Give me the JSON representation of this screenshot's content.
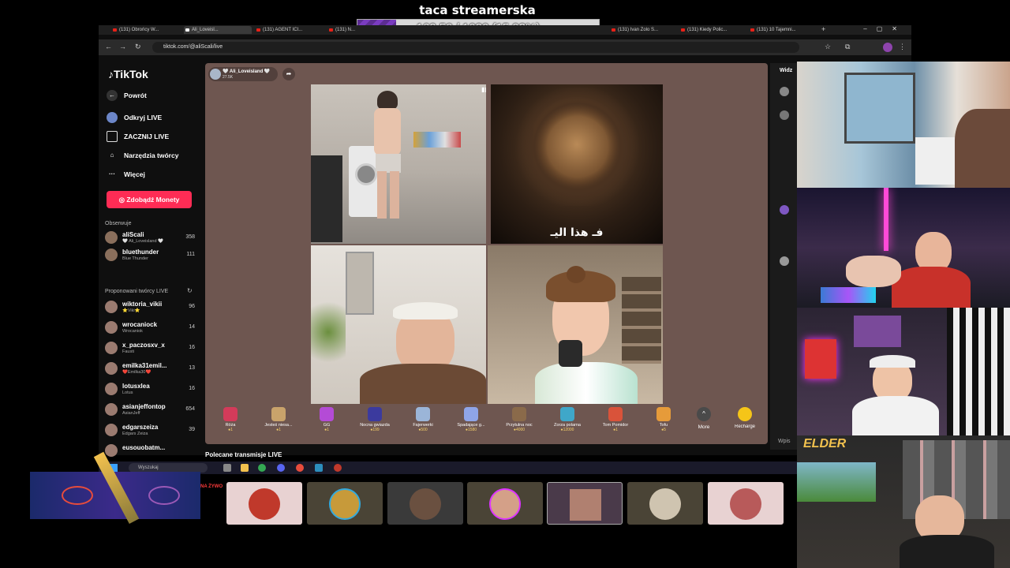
{
  "overlay": {
    "title": "taca streamerska",
    "goal_text": "162.50 / 1020 (15.93%)",
    "goal_progress": 0.1593,
    "goal_colors": [
      "#5c2d91",
      "#7a3cc0"
    ]
  },
  "browser": {
    "tabs": [
      "(131) Obrońcy W...",
      "Ali_Loveisl...",
      "(131) AGENT ICI...",
      "(131) N...",
      "(131) Ivan Zolo S...",
      "(131) Kiedy Polic...",
      "(131) 10 Tajemni..."
    ],
    "url": "tiktok.com/@aliScali/live"
  },
  "tiktok": {
    "logo": "TikTok",
    "nav": [
      "Powrót",
      "Odkryj LIVE",
      "ZACZNIJ LIVE",
      "Narzędzia twórcy",
      "Więcej"
    ],
    "coins_button": "Zdobądź Monety",
    "following_title": "Obserwuje",
    "following": [
      {
        "name": "aliScali",
        "sub": "🤍 Ali_Loveisland 🤍",
        "count": "358"
      },
      {
        "name": "bluethunder",
        "sub": "Blue Thunder",
        "count": "111"
      }
    ],
    "suggested_title": "Proponowani twórcy LIVE",
    "suggested": [
      {
        "name": "wiktoria_vikii",
        "sub": "⭐Viki⭐",
        "count": "96"
      },
      {
        "name": "wrocaniock",
        "sub": "Wrocaniok",
        "count": "14"
      },
      {
        "name": "x_paczosxv_x",
        "sub": "Fausti",
        "count": "16"
      },
      {
        "name": "emilka31emil...",
        "sub": "❤️Emilka30❤️",
        "count": "13"
      },
      {
        "name": "lotusxlea",
        "sub": "Lotus",
        "count": "16"
      },
      {
        "name": "asianjeffontop",
        "sub": "AsianJeff",
        "count": "654"
      },
      {
        "name": "edgarszeiza",
        "sub": "Edgars Zeiza",
        "count": "39"
      },
      {
        "name": "eusouobatm...",
        "sub": "",
        "count": ""
      }
    ],
    "host": {
      "name": "🤍 Ali_Loveisland 🤍",
      "viewers": "27.5K"
    },
    "lion_caption": "فـ هذا اليـ",
    "gifts": [
      {
        "name": "Róża",
        "price": "1",
        "color": "#d33b5a"
      },
      {
        "name": "Jesteś niesa...",
        "price": "1",
        "color": "#c9a36b"
      },
      {
        "name": "GG",
        "price": "1",
        "color": "#b44bd6"
      },
      {
        "name": "Nocna gwiazda",
        "price": "199",
        "color": "#3b3a9e"
      },
      {
        "name": "Fajerwerki",
        "price": "500",
        "color": "#9bb5d8"
      },
      {
        "name": "Spadające g...",
        "price": "1580",
        "color": "#8fa5e8"
      },
      {
        "name": "Przytulna noc",
        "price": "4000",
        "color": "#8a6a4a"
      },
      {
        "name": "Zorza polarna",
        "price": "12000",
        "color": "#3fa7c9"
      },
      {
        "name": "Tom Pomidor",
        "price": "1",
        "color": "#d9533a"
      },
      {
        "name": "Tofu",
        "price": "5",
        "color": "#e69b3a"
      }
    ],
    "more_label": "More",
    "recharge_label": "Recharge",
    "recommended_label": "Polecane transmisje LIVE"
  },
  "right_panel": {
    "label": "Widz",
    "input": "Wpis"
  },
  "taskbar": {
    "search": "Wyszukaj"
  },
  "viewers": {
    "live_label": "NA ŻYWO",
    "elder_label": "ELDER"
  }
}
